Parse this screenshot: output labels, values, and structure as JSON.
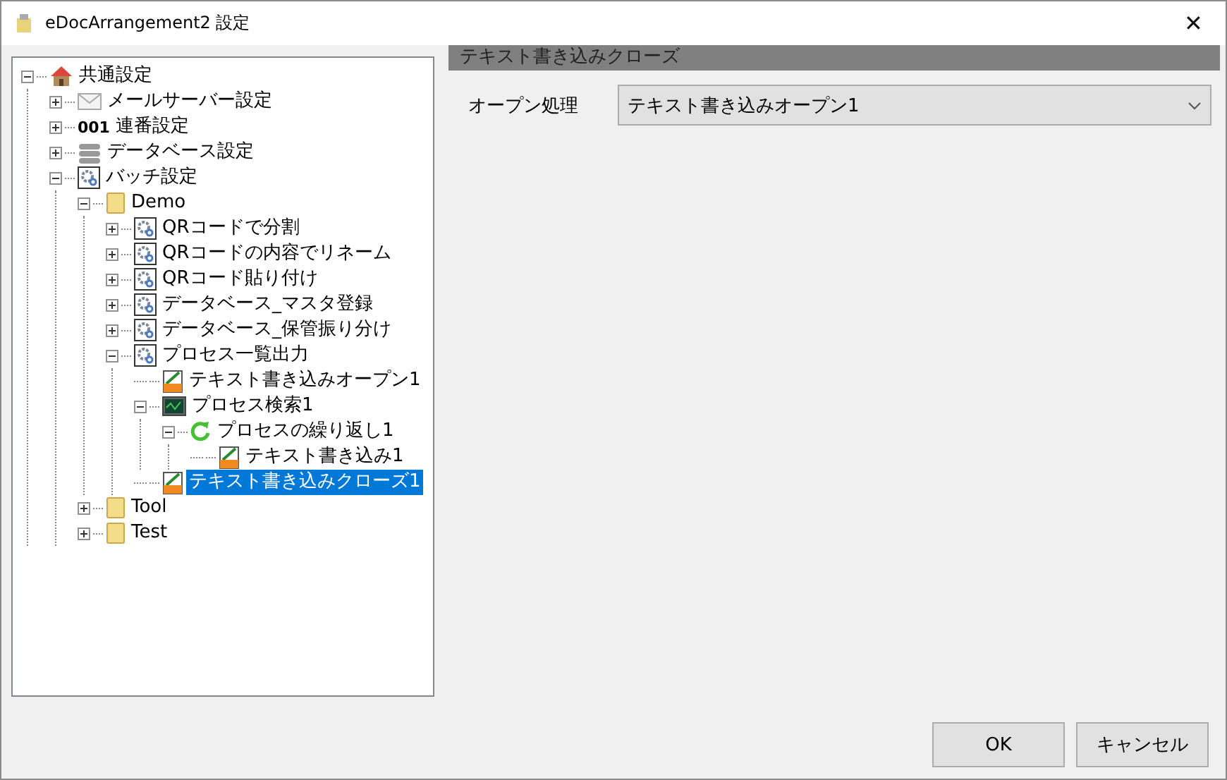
{
  "window": {
    "title": "eDocArrangement2 設定",
    "close": "✕"
  },
  "tree": [
    {
      "label": "共通設定",
      "kind": "house",
      "expanded": true,
      "selected": false,
      "children": [
        {
          "label": "メールサーバー設定",
          "kind": "mail",
          "expanded": false,
          "selected": false
        },
        {
          "label": "連番設定",
          "kind": "serial",
          "icon_text": "001",
          "expanded": false,
          "selected": false
        },
        {
          "label": "データベース設定",
          "kind": "database",
          "expanded": false,
          "selected": false
        },
        {
          "label": "バッチ設定",
          "kind": "gear",
          "expanded": true,
          "selected": false,
          "children": [
            {
              "label": "Demo",
              "kind": "folder",
              "expanded": true,
              "selected": false,
              "children": [
                {
                  "label": "QRコードで分割",
                  "kind": "gear",
                  "expanded": false,
                  "selected": false
                },
                {
                  "label": "QRコードの内容でリネーム",
                  "kind": "gear",
                  "expanded": false,
                  "selected": false
                },
                {
                  "label": "QRコード貼り付け",
                  "kind": "gear",
                  "expanded": false,
                  "selected": false
                },
                {
                  "label": "データベース_マスタ登録",
                  "kind": "gear",
                  "expanded": false,
                  "selected": false
                },
                {
                  "label": "データベース_保管振り分け",
                  "kind": "gear",
                  "expanded": false,
                  "selected": false
                },
                {
                  "label": "プロセス一覧出力",
                  "kind": "gear",
                  "expanded": true,
                  "selected": false,
                  "children": [
                    {
                      "label": "テキスト書き込みオープン1",
                      "kind": "textfile",
                      "selected": false
                    },
                    {
                      "label": "プロセス検索1",
                      "kind": "monitor",
                      "expanded": true,
                      "selected": false,
                      "children": [
                        {
                          "label": "プロセスの繰り返し1",
                          "kind": "loop",
                          "expanded": true,
                          "selected": false,
                          "children": [
                            {
                              "label": "テキスト書き込み1",
                              "kind": "textfile",
                              "selected": false
                            }
                          ]
                        }
                      ]
                    },
                    {
                      "label": "テキスト書き込みクローズ1",
                      "kind": "textfile",
                      "selected": true
                    }
                  ]
                }
              ]
            },
            {
              "label": "Tool",
              "kind": "folder",
              "expanded": false,
              "selected": false
            },
            {
              "label": "Test",
              "kind": "folder",
              "expanded": false,
              "selected": false
            }
          ]
        }
      ]
    }
  ],
  "panel": {
    "header": "テキスト書き込みクローズ",
    "field_label": "オープン処理",
    "field_value": "テキスト書き込みオープン1"
  },
  "buttons": [
    "OK",
    "キャンセル"
  ]
}
